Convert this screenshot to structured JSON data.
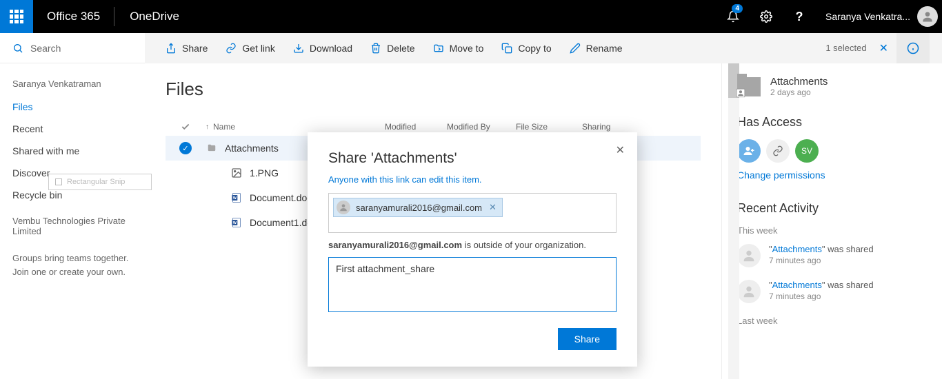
{
  "header": {
    "brand": "Office 365",
    "app": "OneDrive",
    "notifications": "4",
    "user": "Saranya Venkatra..."
  },
  "search": {
    "placeholder": "Search"
  },
  "commands": {
    "share": "Share",
    "getlink": "Get link",
    "download": "Download",
    "delete": "Delete",
    "moveto": "Move to",
    "copyto": "Copy to",
    "rename": "Rename",
    "selected": "1 selected"
  },
  "nav": {
    "owner": "Saranya Venkatraman",
    "files": "Files",
    "recent": "Recent",
    "shared": "Shared with me",
    "discover": "Discover",
    "recycle": "Recycle bin",
    "org": "Vembu Technologies Private Limited",
    "footer1": "Groups bring teams together.",
    "footer2": "Join one or create your own.",
    "ghost": "Rectangular Snip"
  },
  "main": {
    "title": "Files",
    "cols": {
      "name": "Name",
      "modified": "Modified",
      "modifiedby": "Modified By",
      "filesize": "File Size",
      "sharing": "Sharing"
    },
    "rows": {
      "r0": "Attachments",
      "r1": "1.PNG",
      "r2": "Document.docx",
      "r3": "Document1.docx"
    }
  },
  "right": {
    "item_title": "Attachments",
    "item_sub": "2 days ago",
    "access_title": "Has Access",
    "initials": "SV",
    "change_perm": "Change permissions",
    "activity_title": "Recent Activity",
    "thisweek": "This week",
    "lastweek": "Last week",
    "act1_pre": "\"",
    "act1_link": "Attachments",
    "act1_post": "\" was shared",
    "act1_time": "7 minutes ago",
    "act2_pre": "\"",
    "act2_link": "Attachments",
    "act2_post": "\" was shared",
    "act2_time": "7 minutes ago"
  },
  "modal": {
    "title": "Share 'Attachments'",
    "sublink": "Anyone with this link can edit this item.",
    "chip_email": "saranyamurali2016@gmail.com",
    "outside_email": "saranyamurali2016@gmail.com",
    "outside_rest": " is outside of your organization.",
    "message": "First attachment_share",
    "share_btn": "Share"
  }
}
